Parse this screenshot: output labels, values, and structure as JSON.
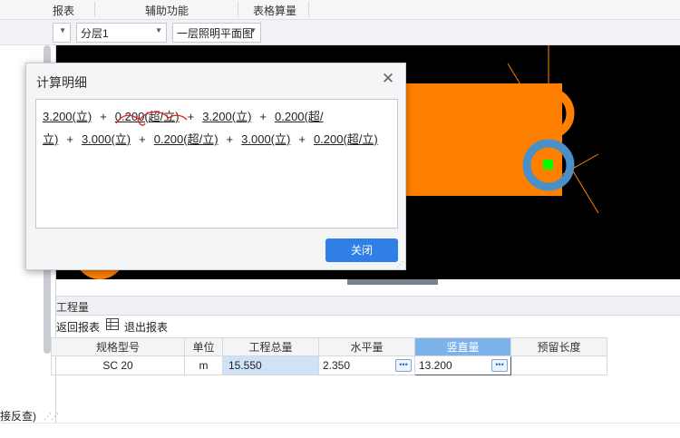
{
  "ribbon": {
    "tabs": [
      "报表",
      "辅助功能",
      "表格算量"
    ]
  },
  "toolbar": {
    "combo1": "",
    "combo2": "分层1",
    "combo3": "一层照明平面图"
  },
  "left_panel": {
    "hint": "接反查)"
  },
  "dialog": {
    "title": "计算明细",
    "formula": [
      "3.200(立)",
      "+",
      "0.200(超/立)",
      "+",
      "3.200(立)",
      "+",
      "0.200(超/立)",
      "+",
      "3.000(立)",
      "+",
      "0.200(超/立)",
      "+",
      "3.000(立)",
      "+",
      "0.200(超/立)"
    ],
    "close_button": "关闭"
  },
  "quantity_panel": {
    "header": "工程量",
    "tools": {
      "back": "返回报表",
      "exit": "退出报表"
    },
    "columns": [
      "规格型号",
      "单位",
      "工程总量",
      "水平量",
      "竖直量",
      "预留长度"
    ],
    "rows": [
      {
        "spec": "SC 20",
        "unit": "m",
        "total": "15.550",
        "horizontal": "2.350",
        "vertical": "13.200",
        "reserved": ""
      }
    ]
  },
  "colors": {
    "accent": "#2f7fe6",
    "selected_header": "#7db3ea",
    "pipe_orange": "#ff8000",
    "pipe_blue": "#4a8fc8",
    "marker_green": "#00ff00"
  }
}
